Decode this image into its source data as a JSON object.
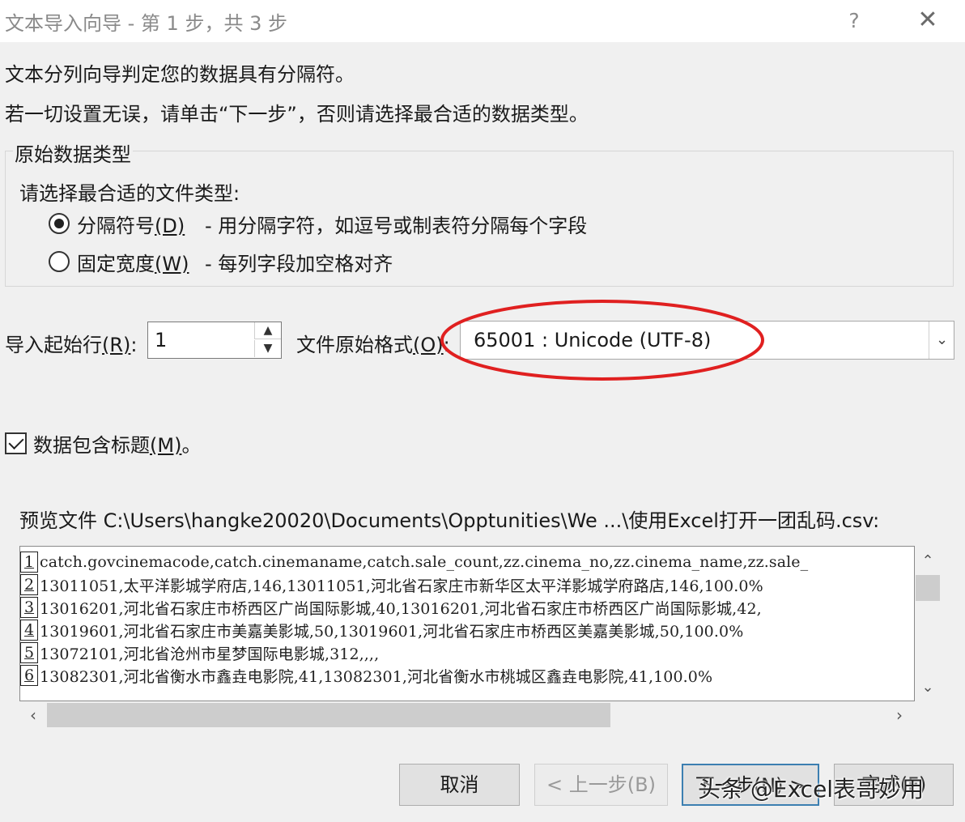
{
  "window": {
    "title": "文本导入向导 - 第 1 步，共 3 步",
    "help": "?",
    "close": "✕"
  },
  "intro": {
    "line1": "文本分列向导判定您的数据具有分隔符。",
    "line2": "若一切设置无误，请单击“下一步”，否则请选择最合适的数据类型。"
  },
  "original_type": {
    "group_title": "原始数据类型",
    "prompt": "请选择最合适的文件类型:",
    "options": [
      {
        "label": "分隔符号",
        "hotkey": "(D)",
        "description": "- 用分隔字符，如逗号或制表符分隔每个字段",
        "selected": true
      },
      {
        "label": "固定宽度",
        "hotkey": "(W)",
        "description": "- 每列字段加空格对齐",
        "selected": false
      }
    ]
  },
  "start_row": {
    "label": "导入起始行",
    "hotkey": "(R)",
    "suffix": ":",
    "value": "1"
  },
  "file_origin": {
    "label": "文件原始格式",
    "hotkey": "(O)",
    "suffix": ":",
    "value": "65001 : Unicode (UTF-8)",
    "annotation_color": "#e02020"
  },
  "has_headers": {
    "label": "数据包含标题",
    "hotkey": "(M)",
    "suffix": "。",
    "checked": true
  },
  "preview": {
    "label": "预览文件 C:\\Users\\hangke20020\\Documents\\Opptunities\\We ...\\使用Excel打开一团乱码.csv:",
    "rows": [
      {
        "num": "1",
        "text": "catch.govcinemacode,catch.cinemaname,catch.sale_count,zz.cinema_no,zz.cinema_name,zz.sale_"
      },
      {
        "num": "2",
        "text": "13011051,太平洋影城学府店,146,13011051,河北省石家庄市新华区太平洋影城学府路店,146,100.0%"
      },
      {
        "num": "3",
        "text": "13016201,河北省石家庄市桥西区广尚国际影城,40,13016201,河北省石家庄市桥西区广尚国际影城,42,"
      },
      {
        "num": "4",
        "text": "13019601,河北省石家庄市美嘉美影城,50,13019601,河北省石家庄市桥西区美嘉美影城,50,100.0%"
      },
      {
        "num": "5",
        "text": "13072101,河北省沧州市星梦国际电影城,312,,,,"
      },
      {
        "num": "6",
        "text": "13082301,河北省衡水市鑫垚电影院,41,13082301,河北省衡水市桃城区鑫垚电影院,41,100.0%"
      }
    ]
  },
  "buttons": {
    "cancel": "取消",
    "back": "< 上一步(B)",
    "next": "下一步(N) >",
    "finish": "完成(F)"
  },
  "watermark": "头条 @Excel表哥妙用",
  "icons": {
    "spin_up": "▲",
    "spin_down": "▼",
    "dropdown": "⌄",
    "scroll_up": "⌃",
    "scroll_down": "⌄",
    "scroll_left": "‹",
    "scroll_right": "›"
  }
}
